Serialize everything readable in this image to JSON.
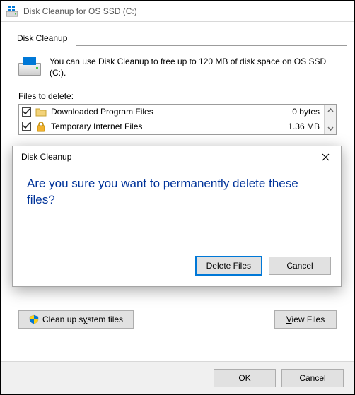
{
  "window": {
    "title": "Disk Cleanup for OS SSD (C:)"
  },
  "tabs": {
    "active_label": "Disk Cleanup"
  },
  "info": {
    "text": "You can use Disk Cleanup to free up to 120 MB of disk space on OS SSD (C:)."
  },
  "files_section": {
    "label": "Files to delete:"
  },
  "file_rows": [
    {
      "label": "Downloaded Program Files",
      "size": "0 bytes",
      "checked": true,
      "icon": "folder-icon"
    },
    {
      "label": "Temporary Internet Files",
      "size": "1.36 MB",
      "checked": true,
      "icon": "lock-icon"
    }
  ],
  "buttons": {
    "cleanup_system_prefix": "Clean up s",
    "cleanup_system_accel": "y",
    "cleanup_system_suffix": "stem files",
    "view_files_accel": "V",
    "view_files_suffix": "iew Files",
    "ok": "OK",
    "cancel": "Cancel"
  },
  "modal": {
    "title": "Disk Cleanup",
    "message": "Are you sure you want to permanently delete these files?",
    "delete": "Delete Files",
    "cancel": "Cancel"
  }
}
